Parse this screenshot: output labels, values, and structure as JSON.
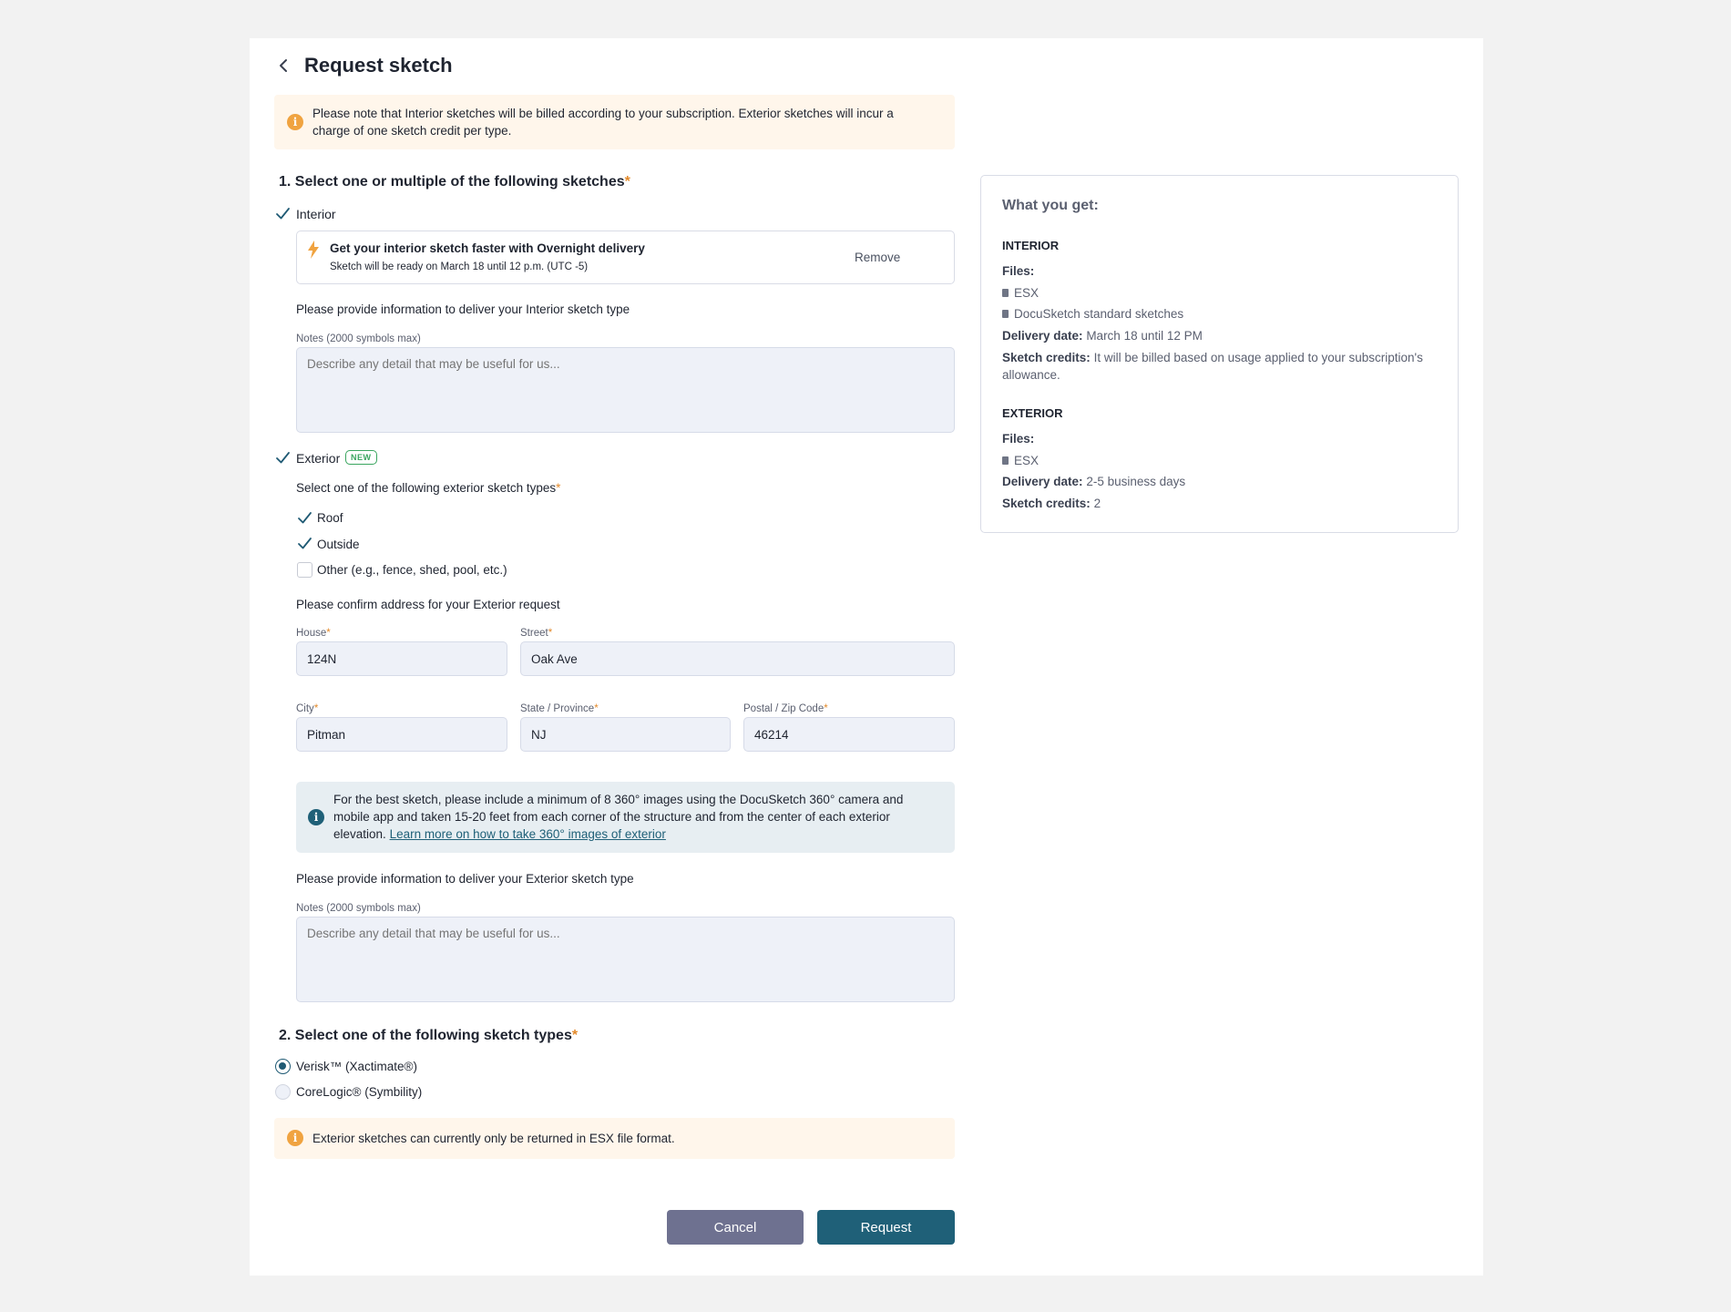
{
  "header": {
    "title": "Request sketch"
  },
  "top_notice": {
    "text": "Please note that Interior sketches will be billed according to your subscription. Exterior sketches will incur a charge of one sketch credit per type."
  },
  "section1": {
    "title": "1. Select one or multiple of the following sketches",
    "required": "*",
    "interior": {
      "label": "Interior",
      "checked": true,
      "promo_title": "Get your interior sketch faster with Overnight delivery",
      "promo_sub": "Sketch will be ready on March 18 until 12 p.m. (UTC -5)",
      "remove_label": "Remove",
      "info_prompt": "Please provide information to deliver your Interior sketch type",
      "notes_label": "Notes (2000 symbols max)",
      "notes_placeholder": "Describe any detail that may be useful for us..."
    },
    "exterior": {
      "label": "Exterior",
      "checked": true,
      "badge": "NEW",
      "types_prompt": "Select one of the following exterior sketch types",
      "types": [
        {
          "label": "Roof",
          "checked": true
        },
        {
          "label": "Outside",
          "checked": true
        },
        {
          "label": "Other (e.g., fence, shed, pool, etc.)",
          "checked": false
        }
      ],
      "address_prompt": "Please confirm address for your Exterior request",
      "house_label": "House",
      "house_value": "124N",
      "street_label": "Street",
      "street_value": "Oak Ave",
      "city_label": "City",
      "city_value": "Pitman",
      "state_label": "State / Province",
      "state_value": "NJ",
      "zip_label": "Postal / Zip Code",
      "zip_value": "46214",
      "info_text": "For the best sketch, please include a minimum of 8 360° images using the DocuSketch 360° camera and mobile app and taken 15-20 feet from each corner of the structure and from the center of each exterior elevation.",
      "info_link": "Learn more on how to take 360° images of exterior",
      "info_prompt": "Please provide information to deliver your Exterior sketch type",
      "notes_label": "Notes (2000 symbols max)",
      "notes_placeholder": "Describe any detail that may be useful for us..."
    }
  },
  "section2": {
    "title": "2. Select one of the following sketch types",
    "required": "*",
    "options": [
      {
        "label": "Verisk™ (Xactimate®)",
        "selected": true
      },
      {
        "label": "CoreLogic® (Symbility)",
        "selected": false
      }
    ],
    "notice": "Exterior sketches can currently only be returned in ESX file format."
  },
  "actions": {
    "cancel": "Cancel",
    "request": "Request"
  },
  "summary": {
    "title": "What you get:",
    "interior": {
      "heading": "INTERIOR",
      "files_label": "Files:",
      "files": [
        "ESX",
        "DocuSketch standard sketches"
      ],
      "delivery_label": "Delivery date:",
      "delivery_value": "March 18 until 12 PM",
      "credits_label": "Sketch credits:",
      "credits_value": "It will be billed based on usage applied to your subscription's allowance."
    },
    "exterior": {
      "heading": "EXTERIOR",
      "files_label": "Files:",
      "files": [
        "ESX"
      ],
      "delivery_label": "Delivery date:",
      "delivery_value": "2-5 business days",
      "credits_label": "Sketch credits:",
      "credits_value": "2"
    }
  },
  "colors": {
    "accent": "#1f6078",
    "warning": "#f0a340",
    "new_badge": "#3aa55f",
    "cancel_button": "#6e7190"
  },
  "icons": [
    "chevron-left-icon",
    "warning-icon",
    "checkmark-icon",
    "lightning-icon",
    "info-icon",
    "file-icon"
  ]
}
